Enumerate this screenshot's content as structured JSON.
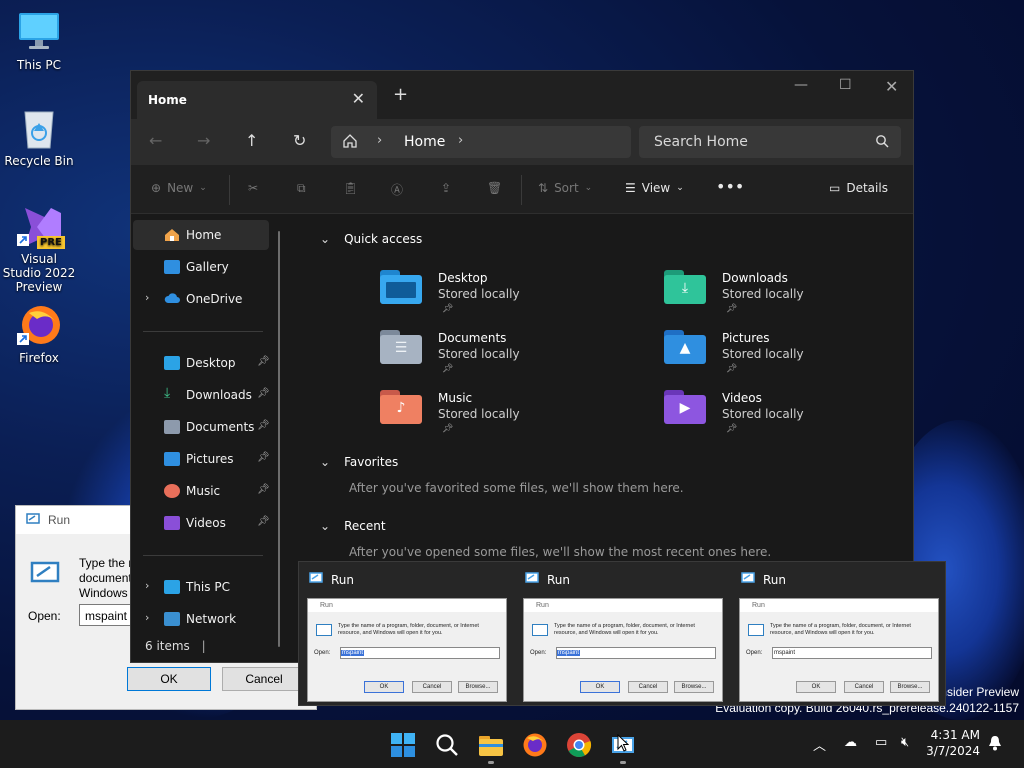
{
  "desktop": {
    "icons": [
      {
        "label": "This PC"
      },
      {
        "label": "Recycle Bin"
      },
      {
        "label": "Visual Studio 2022 Preview",
        "badge": "PRE"
      },
      {
        "label": "Firefox"
      }
    ]
  },
  "run_dialog": {
    "title": "Run",
    "description": "Type the name of a program, folder, document, or Internet resource, and Windows will open it for you.",
    "open_label": "Open:",
    "open_value": "mspaint",
    "ok": "OK",
    "cancel": "Cancel",
    "browse": "Browse..."
  },
  "explorer": {
    "tab_title": "Home",
    "new_tab": "+",
    "breadcrumb": "Home",
    "search_placeholder": "Search Home",
    "toolbar": {
      "new": "New",
      "sort": "Sort",
      "view": "View",
      "details": "Details"
    },
    "sidebar": {
      "top": [
        {
          "label": "Home",
          "icon": "home-icon"
        },
        {
          "label": "Gallery",
          "icon": "gallery-icon"
        },
        {
          "label": "OneDrive",
          "icon": "cloud-icon"
        }
      ],
      "pinned": [
        {
          "label": "Desktop",
          "icon": "desktop-icon"
        },
        {
          "label": "Downloads",
          "icon": "download-icon"
        },
        {
          "label": "Documents",
          "icon": "documents-icon"
        },
        {
          "label": "Pictures",
          "icon": "pictures-icon"
        },
        {
          "label": "Music",
          "icon": "music-icon"
        },
        {
          "label": "Videos",
          "icon": "videos-icon"
        }
      ],
      "bottom": [
        {
          "label": "This PC",
          "icon": "pc-icon"
        },
        {
          "label": "Network",
          "icon": "network-icon"
        }
      ]
    },
    "status": "6 items",
    "sections": {
      "quick_access": "Quick access",
      "favorites": "Favorites",
      "favorites_hint": "After you've favorited some files, we'll show them here.",
      "recent": "Recent",
      "recent_hint": "After you've opened some files, we'll show the most recent ones here."
    },
    "quick_access": [
      {
        "name": "Desktop",
        "sub": "Stored locally"
      },
      {
        "name": "Downloads",
        "sub": "Stored locally"
      },
      {
        "name": "Documents",
        "sub": "Stored locally"
      },
      {
        "name": "Pictures",
        "sub": "Stored locally"
      },
      {
        "name": "Music",
        "sub": "Stored locally"
      },
      {
        "name": "Videos",
        "sub": "Stored locally"
      }
    ]
  },
  "thumbnails": [
    {
      "title": "Run",
      "value": "mspaint",
      "selected": true
    },
    {
      "title": "Run",
      "value": "mspaint",
      "selected": true
    },
    {
      "title": "Run",
      "value": "mspaint",
      "selected": false
    }
  ],
  "watermark": {
    "line1": "nsider Preview",
    "line2": "Evaluation copy. Build 26040.rs_prerelease.240122-1157"
  },
  "taskbar": {
    "time": "4:31 AM",
    "date": "3/7/2024"
  },
  "colors": {
    "accent": "#4cc2ff",
    "taskbar": "#1c1c1c",
    "explorer_bg": "#191919"
  }
}
